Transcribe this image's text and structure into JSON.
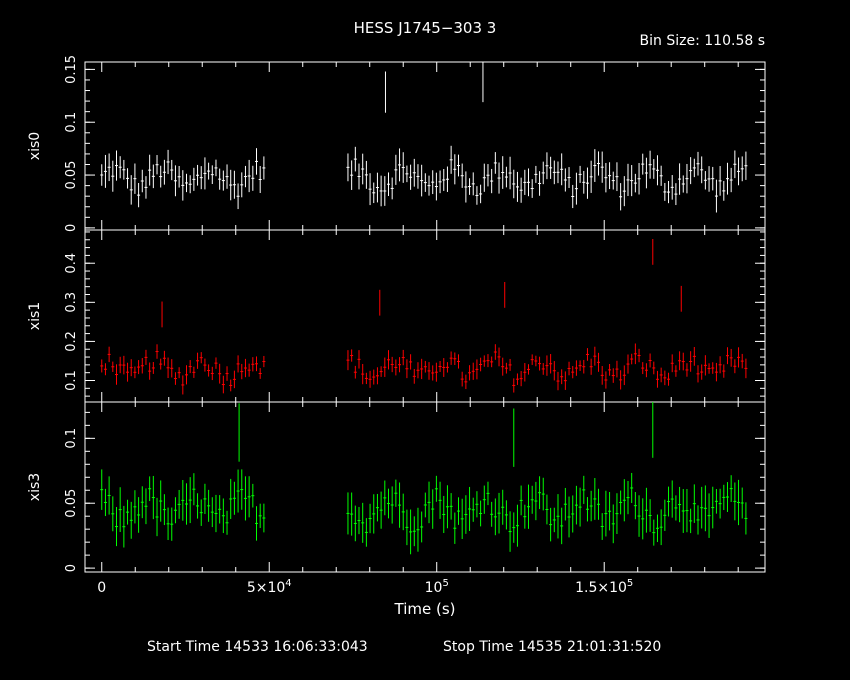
{
  "title": "HESS J1745−303 3",
  "bin_size": "Bin Size: 110.58 s",
  "start_time": "Start Time 14533 16:06:33:043",
  "stop_time": "Stop Time 14535 21:01:31:520",
  "chart_data": {
    "type": "line",
    "xlabel": "Time (s)",
    "xlim": [
      -5000,
      198000
    ],
    "x_ticks": [
      {
        "value": 0,
        "label": "0"
      },
      {
        "value": 50000,
        "label": "5×10",
        "sup": "4"
      },
      {
        "value": 100000,
        "label": "10",
        "sup": "5"
      },
      {
        "value": 150000,
        "label": "1.5×10",
        "sup": "5"
      }
    ],
    "panels": [
      {
        "name": "xis0",
        "ylabel": "xis0",
        "color": "#ffffff",
        "ylim": [
          -0.002,
          0.157
        ],
        "y_ticks": [
          {
            "value": 0,
            "label": "0"
          },
          {
            "value": 0.05,
            "label": "0.05"
          },
          {
            "value": 0.1,
            "label": "0.1"
          },
          {
            "value": 0.15,
            "label": "0.15"
          }
        ],
        "mean": 0.047,
        "amp": 0.014,
        "err": 0.013,
        "spikes": [
          [
            84700,
            0.135
          ],
          [
            113800,
            0.145
          ]
        ]
      },
      {
        "name": "xis1",
        "ylabel": "xis1",
        "color": "#ff0000",
        "ylim": [
          0.045,
          0.485
        ],
        "y_ticks": [
          {
            "value": 0.1,
            "label": "0.1"
          },
          {
            "value": 0.2,
            "label": "0.2"
          },
          {
            "value": 0.3,
            "label": "0.3"
          },
          {
            "value": 0.4,
            "label": "0.4"
          }
        ],
        "mean": 0.13,
        "amp": 0.035,
        "err": 0.022,
        "spikes": [
          [
            18000,
            0.28
          ],
          [
            83000,
            0.31
          ],
          [
            120300,
            0.33
          ],
          [
            164500,
            0.44
          ],
          [
            173000,
            0.32
          ]
        ]
      },
      {
        "name": "xis3",
        "ylabel": "xis3",
        "color": "#00ff00",
        "ylim": [
          -0.003,
          0.128
        ],
        "y_ticks": [
          {
            "value": 0,
            "label": "0"
          },
          {
            "value": 0.05,
            "label": "0.05"
          },
          {
            "value": 0.1,
            "label": "0.1"
          }
        ],
        "mean": 0.045,
        "amp": 0.014,
        "err": 0.015,
        "spikes": [
          [
            41000,
            0.112
          ],
          [
            123000,
            0.108
          ],
          [
            164500,
            0.115
          ]
        ]
      }
    ],
    "segments": [
      [
        0,
        49000
      ],
      [
        73500,
        193000
      ]
    ],
    "bin_size_s": 110.58
  }
}
